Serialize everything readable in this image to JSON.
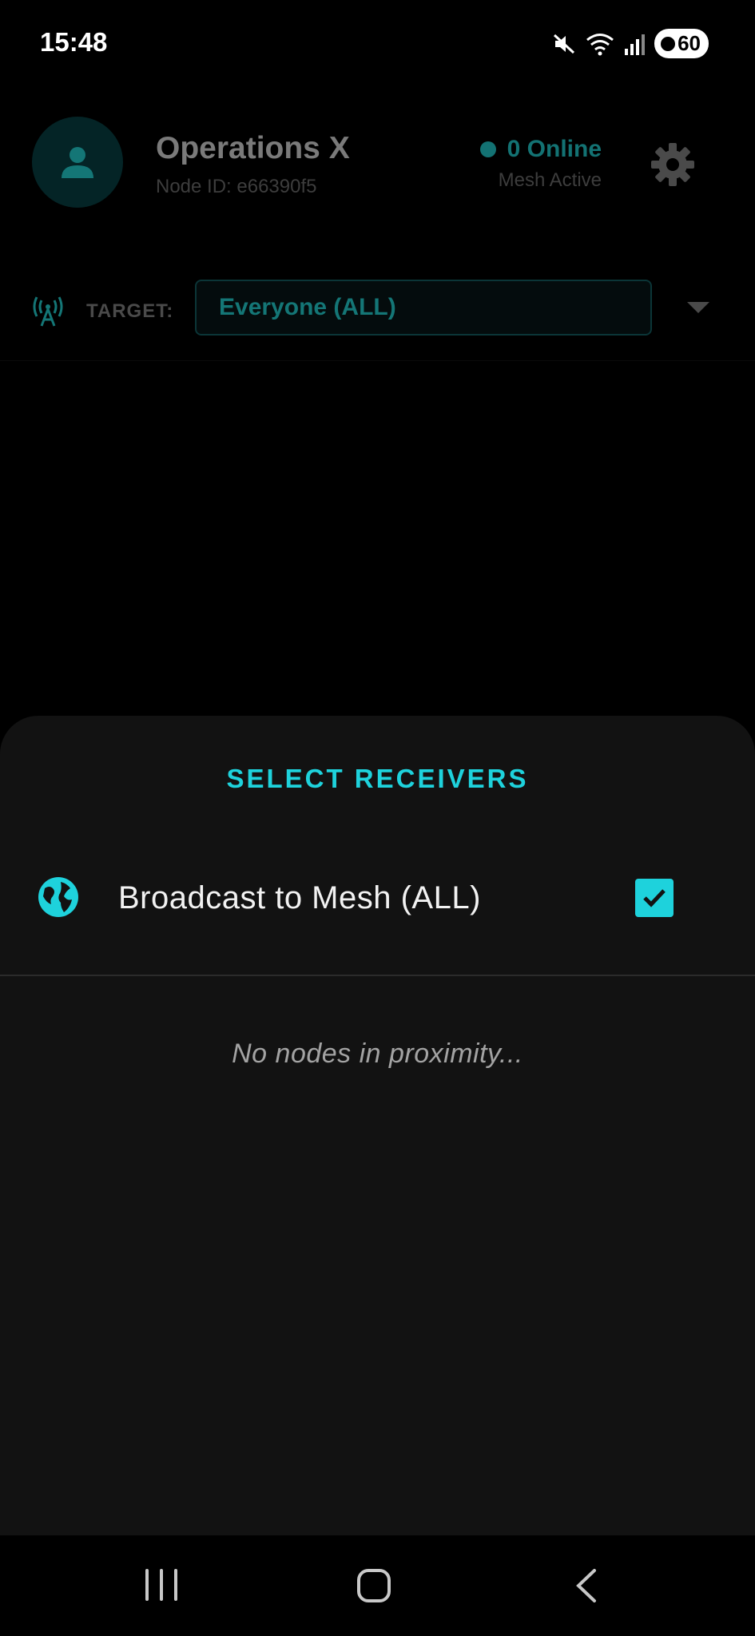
{
  "status_bar": {
    "time": "15:48",
    "icons": [
      "mute-icon",
      "wifi-icon",
      "signal-icon"
    ],
    "battery": "60"
  },
  "header": {
    "avatar_icon": "person-icon",
    "title": "Operations X",
    "node_id": "Node ID: e66390f5",
    "online_count": "0 Online",
    "mesh_status": "Mesh Active",
    "settings_icon": "gear-icon"
  },
  "target": {
    "icon": "antenna-icon",
    "label": "TARGET:",
    "selected": "Everyone (ALL)"
  },
  "sheet": {
    "title": "SELECT RECEIVERS",
    "receivers": [
      {
        "icon": "globe-icon",
        "label": "Broadcast to Mesh (ALL)",
        "checked": true
      }
    ],
    "empty_message": "No nodes in proximity..."
  },
  "nav_bar": {
    "buttons": [
      "recents",
      "home",
      "back"
    ]
  },
  "colors": {
    "accent": "#1ed2dc",
    "accent_dim": "#137273",
    "sheet_bg": "#121212",
    "background": "#000000"
  }
}
